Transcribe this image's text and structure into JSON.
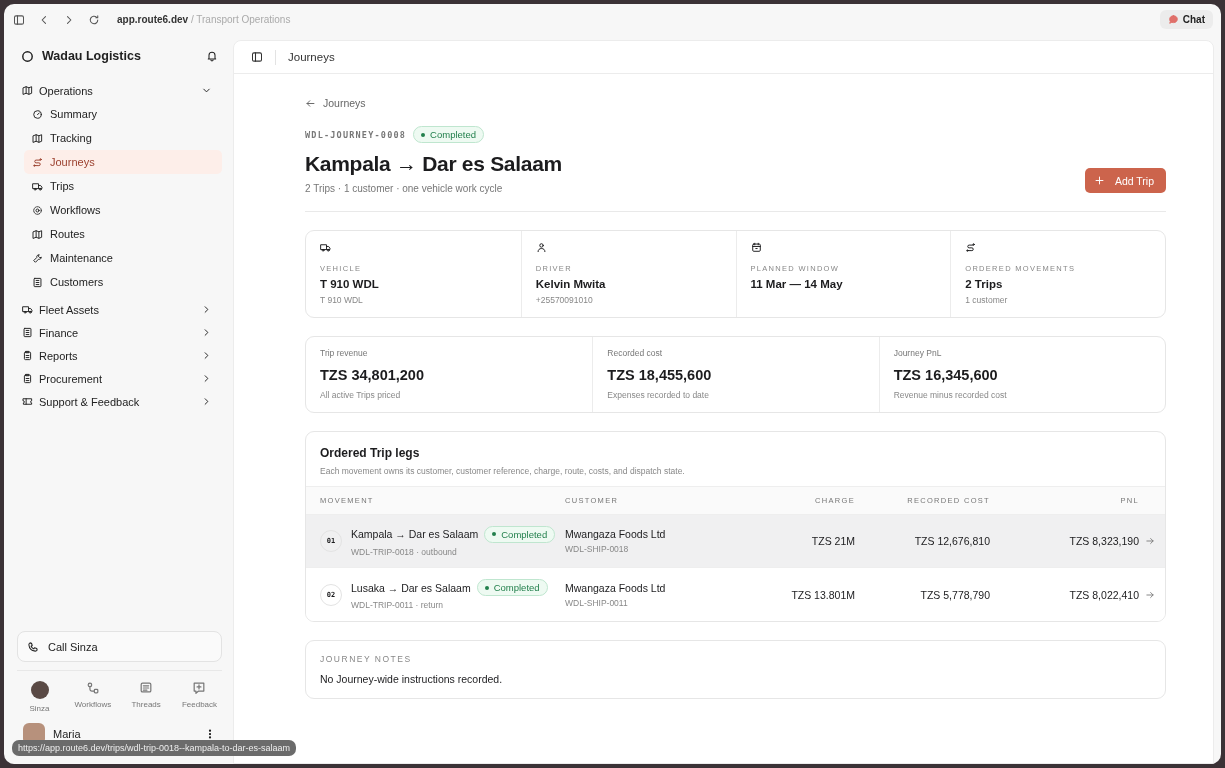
{
  "browser": {
    "url_host": "app.route6.dev",
    "url_path": "/ Transport Operations",
    "chat_button": "Chat"
  },
  "sidebar": {
    "brand": "Wadau Logistics",
    "groups": [
      {
        "label": "Operations",
        "expanded": true,
        "children": [
          {
            "label": "Summary",
            "selected": false
          },
          {
            "label": "Tracking",
            "selected": false
          },
          {
            "label": "Journeys",
            "selected": true
          },
          {
            "label": "Trips",
            "selected": false
          },
          {
            "label": "Workflows",
            "selected": false
          },
          {
            "label": "Routes",
            "selected": false
          },
          {
            "label": "Maintenance",
            "selected": false
          },
          {
            "label": "Customers",
            "selected": false
          }
        ]
      },
      {
        "label": "Fleet Assets",
        "expanded": false
      },
      {
        "label": "Finance",
        "expanded": false
      },
      {
        "label": "Reports",
        "expanded": false
      },
      {
        "label": "Procurement",
        "expanded": false
      },
      {
        "label": "Support & Feedback",
        "expanded": false
      }
    ],
    "call_button": "Call Sinza",
    "dock": [
      {
        "label": "Sinza",
        "kind": "avatar"
      },
      {
        "label": "Workflows",
        "kind": "icon"
      },
      {
        "label": "Threads",
        "kind": "icon"
      },
      {
        "label": "Feedback",
        "kind": "icon"
      }
    ],
    "user": "Maria"
  },
  "header": {
    "title": "Journeys"
  },
  "page": {
    "back_link": "Journeys",
    "journey_id": "WDL-JOURNEY-0008",
    "status": "Completed",
    "title": "Kampala → Dar es Salaam",
    "subtitle": "2 Trips · 1 customer · one vehicle work cycle",
    "add_button": "Add Trip"
  },
  "facts": [
    {
      "label": "VEHICLE",
      "value": "T 910 WDL",
      "detail": "T 910 WDL"
    },
    {
      "label": "DRIVER",
      "value": "Kelvin Mwita",
      "detail": "+25570091010"
    },
    {
      "label": "PLANNED WINDOW",
      "value": "11 Mar — 14 May"
    },
    {
      "label": "ORDERED MOVEMENTS",
      "value": "2 Trips",
      "detail": "1 customer"
    }
  ],
  "money": [
    {
      "label": "Trip revenue",
      "value": "TZS 34,801,200",
      "detail": "All active Trips priced"
    },
    {
      "label": "Recorded cost",
      "value": "TZS 18,455,600",
      "detail": "Expenses recorded to date"
    },
    {
      "label": "Journey PnL",
      "value": "TZS 16,345,600",
      "detail": "Revenue minus recorded cost"
    }
  ],
  "legs": {
    "title": "Ordered Trip legs",
    "description": "Each movement owns its customer, customer reference, charge, route, costs, and dispatch state.",
    "columns": [
      "MOVEMENT",
      "CUSTOMER",
      "CHARGE",
      "RECORDED COST",
      "PNL"
    ],
    "rows": [
      {
        "number": "01",
        "route": "Kampala → Dar es Salaam",
        "status": "Completed",
        "reference": "WDL-TRIP-0018 · outbound",
        "customer": "Mwangaza Foods Ltd",
        "customer_ref": "WDL-SHIP-0018",
        "charge": "TZS 21M",
        "cost": "TZS 12,676,810",
        "pnl": "TZS 8,323,190",
        "hovered": true
      },
      {
        "number": "02",
        "route": "Lusaka → Dar es Salaam",
        "status": "Completed",
        "reference": "WDL-TRIP-0011 · return",
        "customer": "Mwangaza Foods Ltd",
        "customer_ref": "WDL-SHIP-0011",
        "charge": "TZS 13.801M",
        "cost": "TZS 5,778,790",
        "pnl": "TZS 8,022,410",
        "hovered": false
      }
    ]
  },
  "notes": {
    "label": "JOURNEY NOTES",
    "text": "No Journey-wide instructions recorded."
  },
  "status_bar": {
    "link_url": "https://app.route6.dev/trips/wdl-trip-0018--kampala-to-dar-es-salaam"
  }
}
